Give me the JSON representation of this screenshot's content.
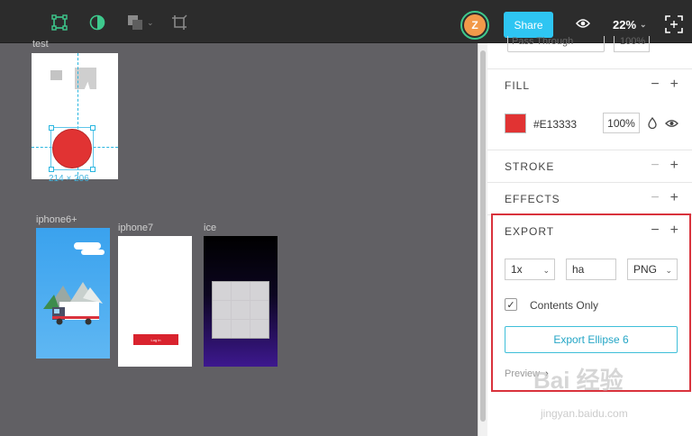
{
  "toolbar": {
    "avatar_initial": "Z",
    "share_label": "Share",
    "zoom_value": "22%"
  },
  "canvas": {
    "artboards": [
      {
        "label": "test",
        "dimension": "214 × 206"
      },
      {
        "label": "iphone6+"
      },
      {
        "label": "iphone7",
        "button_text": "Log in"
      },
      {
        "label": "ice"
      }
    ]
  },
  "panel": {
    "blend_mode": "Pass Through",
    "layer_opacity": "100%",
    "fill": {
      "title": "FILL",
      "hex": "#E13333",
      "opacity": "100%",
      "color": "#e13333"
    },
    "stroke": {
      "title": "STROKE"
    },
    "effects": {
      "title": "EFFECTS"
    },
    "export": {
      "title": "EXPORT",
      "scale": "1x",
      "suffix": "ha",
      "format": "PNG",
      "contents_only": "Contents Only",
      "button": "Export Ellipse 6",
      "preview": "Preview"
    },
    "minus": "−",
    "plus": "+"
  },
  "watermark": {
    "main": "Bai 经验",
    "sub": "jingyan.baidu.com"
  }
}
